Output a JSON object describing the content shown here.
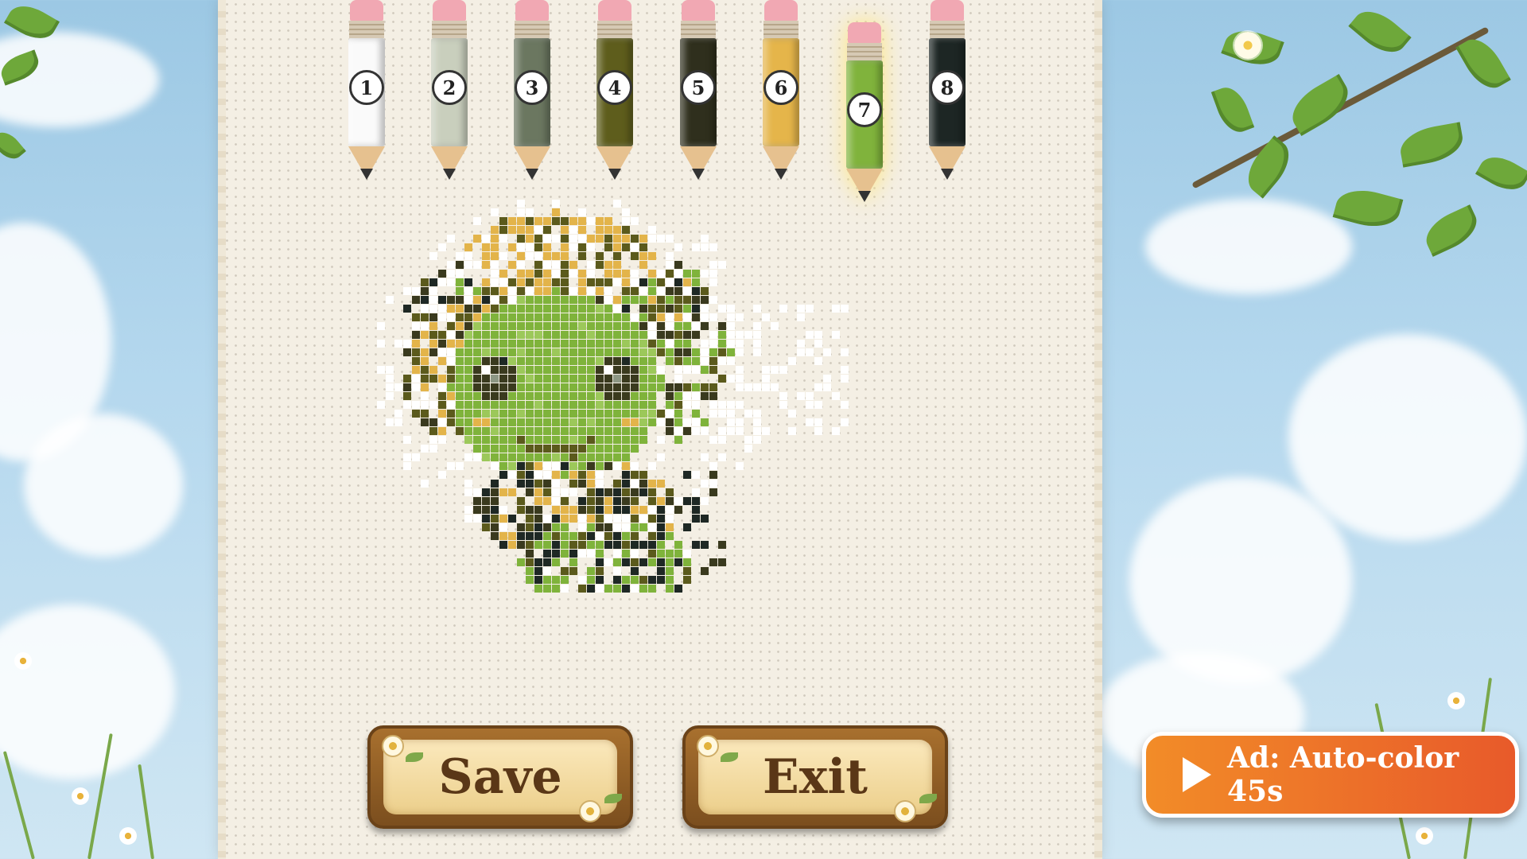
{
  "palette": {
    "pencils": [
      {
        "number": "1",
        "color": "#fafafa"
      },
      {
        "number": "2",
        "color": "#c9cfbd"
      },
      {
        "number": "3",
        "color": "#6b7760"
      },
      {
        "number": "4",
        "color": "#5e5d1c"
      },
      {
        "number": "5",
        "color": "#2f2f1d"
      },
      {
        "number": "6",
        "color": "#e5b54a"
      },
      {
        "number": "7",
        "color": "#80b33c",
        "selected": true
      },
      {
        "number": "8",
        "color": "#1d2624"
      }
    ]
  },
  "actions": {
    "save_label": "Save",
    "exit_label": "Exit"
  },
  "ad": {
    "label": "Ad: Auto-color 45s",
    "icon": "play-icon",
    "color_start": "#f28c28",
    "color_end": "#e85a2a"
  },
  "artwork": {
    "subject": "pixel-art green creature in progress",
    "colors": {
      "white": "#ffffff",
      "green": "#7fb33b",
      "lightgreen": "#9cc85a",
      "olive": "#5b5a1c",
      "darkolive": "#3a3a1e",
      "dark": "#1e2824",
      "gold": "#e3b44a",
      "grey": "#8d9784"
    }
  }
}
